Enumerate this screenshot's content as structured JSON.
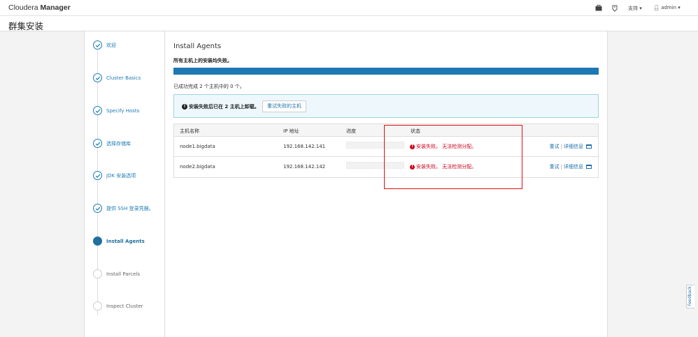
{
  "app": {
    "brand_light": "Cloudera",
    "brand_bold": "Manager",
    "nav": {
      "support_label": "支持",
      "user_label": "admin"
    }
  },
  "page": {
    "title": "群集安装"
  },
  "steps": [
    {
      "label": "欢迎",
      "state": "done"
    },
    {
      "label": "Cluster Basics",
      "state": "done"
    },
    {
      "label": "Specify Hosts",
      "state": "done"
    },
    {
      "label": "选择存储库",
      "state": "done"
    },
    {
      "label": "JDK 安装选项",
      "state": "done"
    },
    {
      "label": "提供 SSH 登录凭据。",
      "state": "done"
    },
    {
      "label": "Install Agents",
      "state": "active"
    },
    {
      "label": "Install Parcels",
      "state": "pending"
    },
    {
      "label": "Inspect Cluster",
      "state": "pending"
    }
  ],
  "content": {
    "heading": "Install Agents",
    "summary": "所有主机上的安装均失败。",
    "progress": 1.0,
    "success_line": "已成功完成 2 个主机中的 0 个。",
    "alert": {
      "text": "安装失败后已在 2 主机上卸载。",
      "retry_button": "重试失败的主机"
    },
    "table": {
      "columns": [
        "主机名称",
        "IP 地址",
        "进度",
        "状态"
      ],
      "rows": [
        {
          "host": "node1.bigdata",
          "ip": "192.168.142.141",
          "status": "安装失败。 无法检测分配。",
          "retry": "重试",
          "details": "详细信息"
        },
        {
          "host": "node2.bigdata",
          "ip": "192.168.142.142",
          "status": "安装失败。 无法检测分配。",
          "retry": "重试",
          "details": "详细信息"
        }
      ]
    }
  },
  "feedback_label": "Feedback",
  "colors": {
    "accent": "#1f78b4",
    "error": "#d0021b",
    "highlight": "#e01010"
  }
}
